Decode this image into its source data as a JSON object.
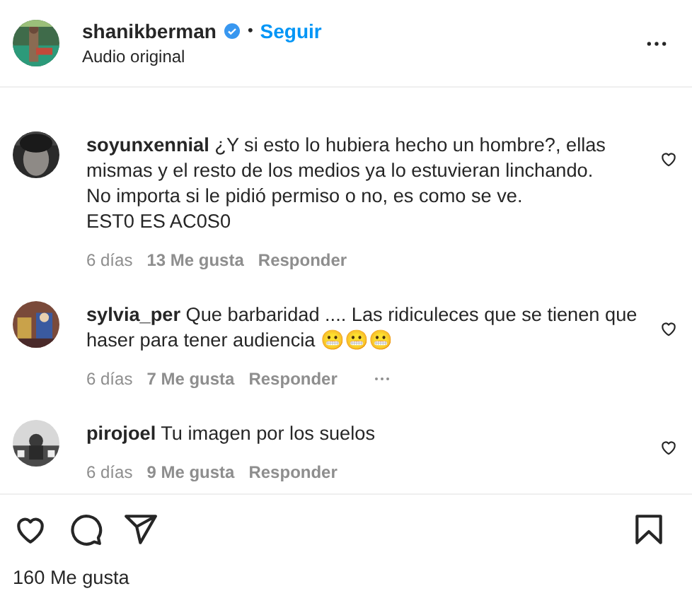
{
  "header": {
    "username": "shanikberman",
    "verified": true,
    "separator": "•",
    "follow": "Seguir",
    "audio": "Audio original"
  },
  "comments": [
    {
      "username": "soyunxennial",
      "text": "¿Y si esto lo hubiera hecho un hombre?, ellas mismas y el resto de los medios ya lo estuvieran linchando.\nNo importa si le pidió permiso o no, es como se ve.\nEST0 ES AC0S0",
      "time": "6 días",
      "likes": "13 Me gusta",
      "reply": "Responder",
      "more": false
    },
    {
      "username": "sylvia_per",
      "text": "Que barbaridad .... Las ridiculeces que se tienen que haser para tener audiencia 😬😬😬",
      "time": "6 días",
      "likes": "7 Me gusta",
      "reply": "Responder",
      "more": true
    },
    {
      "username": "pirojoel",
      "text": "Tu imagen por los suelos",
      "time": "6 días",
      "likes": "9 Me gusta",
      "reply": "Responder",
      "more": false
    }
  ],
  "likes": "160 Me gusta"
}
